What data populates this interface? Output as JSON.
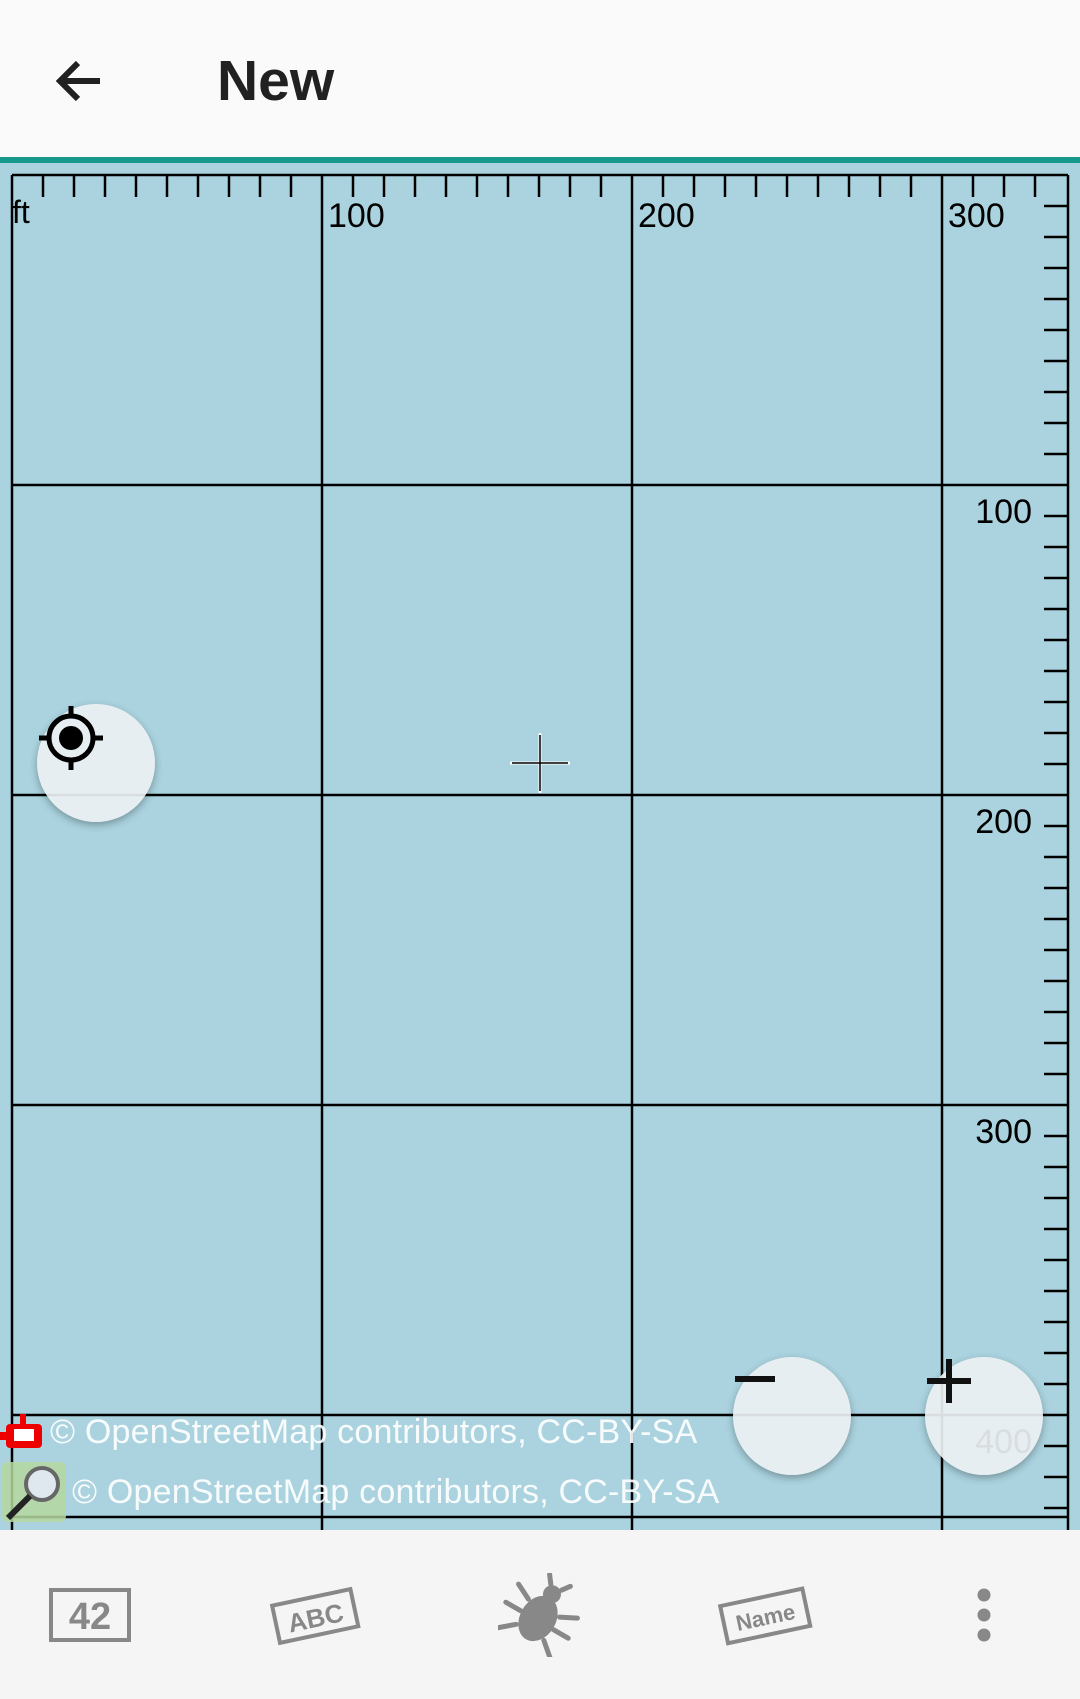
{
  "header": {
    "title": "New",
    "back_icon": "arrow-left-icon"
  },
  "map": {
    "background_color": "#aad3df",
    "unit": "ft",
    "scale_top_labels": [
      "100",
      "200",
      "300"
    ],
    "scale_right_labels": [
      "100",
      "200",
      "300",
      "400"
    ],
    "attribution_lines": [
      "© OpenStreetMap contributors, CC-BY-SA",
      "© OpenStreetMap contributors, CC-BY-SA"
    ]
  },
  "controls": {
    "locate_icon": "gps-locate-icon",
    "zoom_out_icon": "minus-icon",
    "zoom_in_icon": "plus-icon",
    "crosshair_icon": "crosshair-icon"
  },
  "bottom_bar": {
    "items": [
      {
        "label": "42",
        "icon": "number-tag-icon"
      },
      {
        "label": "ABC",
        "icon": "text-tag-icon"
      },
      {
        "label": "",
        "icon": "bug-icon"
      },
      {
        "label": "Name",
        "icon": "name-tag-icon"
      },
      {
        "label": "",
        "icon": "overflow-menu-icon"
      }
    ]
  },
  "accent_color": "#16998a"
}
